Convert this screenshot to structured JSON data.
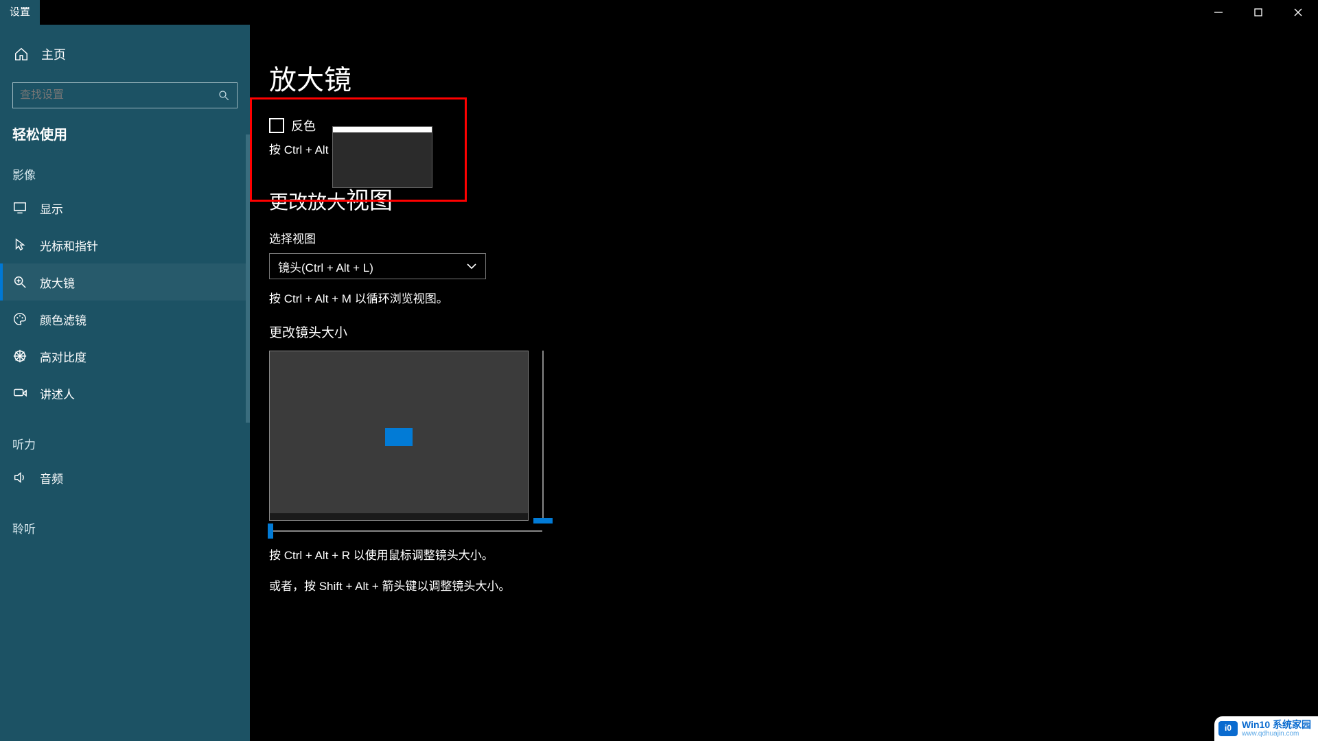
{
  "window": {
    "title": "设置"
  },
  "caption": {
    "min": "minimize",
    "max": "maximize",
    "close": "close"
  },
  "sidebar": {
    "home": "主页",
    "search_placeholder": "查找设置",
    "section": "轻松使用",
    "groups": [
      {
        "label": "影像",
        "items": [
          {
            "id": "display",
            "icon": "monitor-icon",
            "label": "显示"
          },
          {
            "id": "cursor",
            "icon": "cursor-icon",
            "label": "光标和指针"
          },
          {
            "id": "magnifier",
            "icon": "magnifier-plus-icon",
            "label": "放大镜",
            "active": true
          },
          {
            "id": "color-filters",
            "icon": "palette-icon",
            "label": "颜色滤镜"
          },
          {
            "id": "high-contrast",
            "icon": "contrast-icon",
            "label": "高对比度"
          },
          {
            "id": "narrator",
            "icon": "narrator-icon",
            "label": "讲述人"
          }
        ]
      },
      {
        "label": "听力",
        "items": [
          {
            "id": "audio",
            "icon": "speaker-icon",
            "label": "音频"
          }
        ]
      },
      {
        "label": "聆听",
        "items": []
      }
    ]
  },
  "page": {
    "title": "放大镜",
    "invert": {
      "label": "反色",
      "hint": "按 Ctrl + Alt + I 以反色。"
    },
    "change_view": {
      "heading_prefix": "更改放大",
      "heading_emph": "视图",
      "select_label": "选择视图",
      "select_value": "镜头(Ctrl + Alt + L)",
      "cycle_hint": "按 Ctrl + Alt + M 以循环浏览视图。"
    },
    "lens": {
      "heading": "更改镜头大小",
      "hint_resize": "按 Ctrl + Alt + R 以使用鼠标调整镜头大小。",
      "hint_shift": "或者，按 Shift + Alt + 箭头键以调整镜头大小。"
    }
  },
  "watermark": {
    "badge": "i0",
    "line1": "Win10 系统家园",
    "line2": "www.qdhuajin.com"
  }
}
